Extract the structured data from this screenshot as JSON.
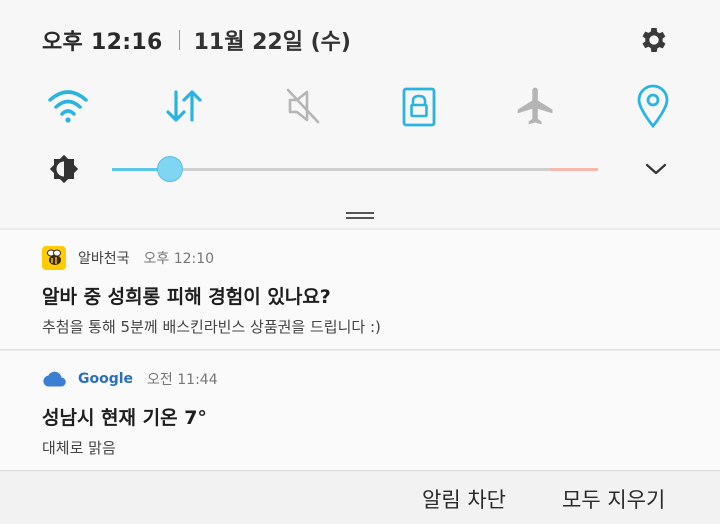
{
  "status": {
    "time": "오후 12:16",
    "date": "11월 22일 (수)"
  },
  "quick_settings": [
    {
      "name": "wifi",
      "icon": "wifi-icon",
      "active": true
    },
    {
      "name": "mobile-data",
      "icon": "data-arrows-icon",
      "active": true
    },
    {
      "name": "sound",
      "icon": "mute-icon",
      "active": false
    },
    {
      "name": "secure-folder",
      "icon": "lock-icon",
      "active": true
    },
    {
      "name": "airplane-mode",
      "icon": "airplane-icon",
      "active": false
    },
    {
      "name": "location",
      "icon": "location-pin-icon",
      "active": true
    }
  ],
  "brightness": {
    "level": 0.12
  },
  "colors": {
    "accent": "#2ab4e2",
    "inactive": "#b5b5b5",
    "slider_fill": "#5bc8e8",
    "slider_warn": "#f4b8ad"
  },
  "notifications": [
    {
      "app": "알바천국",
      "time": "오후 12:10",
      "title": "알바 중 성희롱 피해 경험이 있나요?",
      "body": "추첨을 통해 5분께 배스킨라빈스 상품권을 드립니다 :)"
    },
    {
      "app": "Google",
      "time": "오전 11:44",
      "title": "성남시 현재 기온 7°",
      "body": "대체로 맑음"
    }
  ],
  "actions": {
    "block": "알림 차단",
    "clear_all": "모두 지우기"
  }
}
